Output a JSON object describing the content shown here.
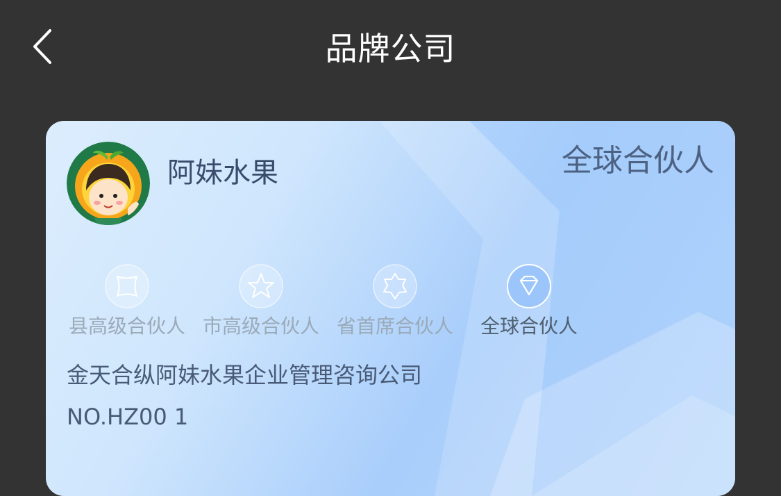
{
  "nav": {
    "title": "品牌公司",
    "back_icon": "chevron-left-icon"
  },
  "card": {
    "brand_name": "阿妹水果",
    "level_title": "全球合伙人",
    "avatar": "brand-logo-avatar",
    "levels": [
      {
        "label": "县高级合伙人",
        "icon": "square-badge-icon",
        "active": false
      },
      {
        "label": "市高级合伙人",
        "icon": "star-badge-icon",
        "active": false
      },
      {
        "label": "省首席合伙人",
        "icon": "hexagon-badge-icon",
        "active": false
      },
      {
        "label": "全球合伙人",
        "icon": "diamond-badge-icon",
        "active": true
      }
    ],
    "company": "金天合纵阿妹水果企业管理咨询公司",
    "number": "NO.HZ00 1"
  },
  "colors": {
    "background": "#333333",
    "nav_text": "#ffffff",
    "card_gradient_start": "#dcedfd",
    "card_gradient_end": "#a9cefb",
    "active_label": "#4e6070",
    "inactive_label": "#9aaab8",
    "active_badge": "#9cc6fb"
  }
}
